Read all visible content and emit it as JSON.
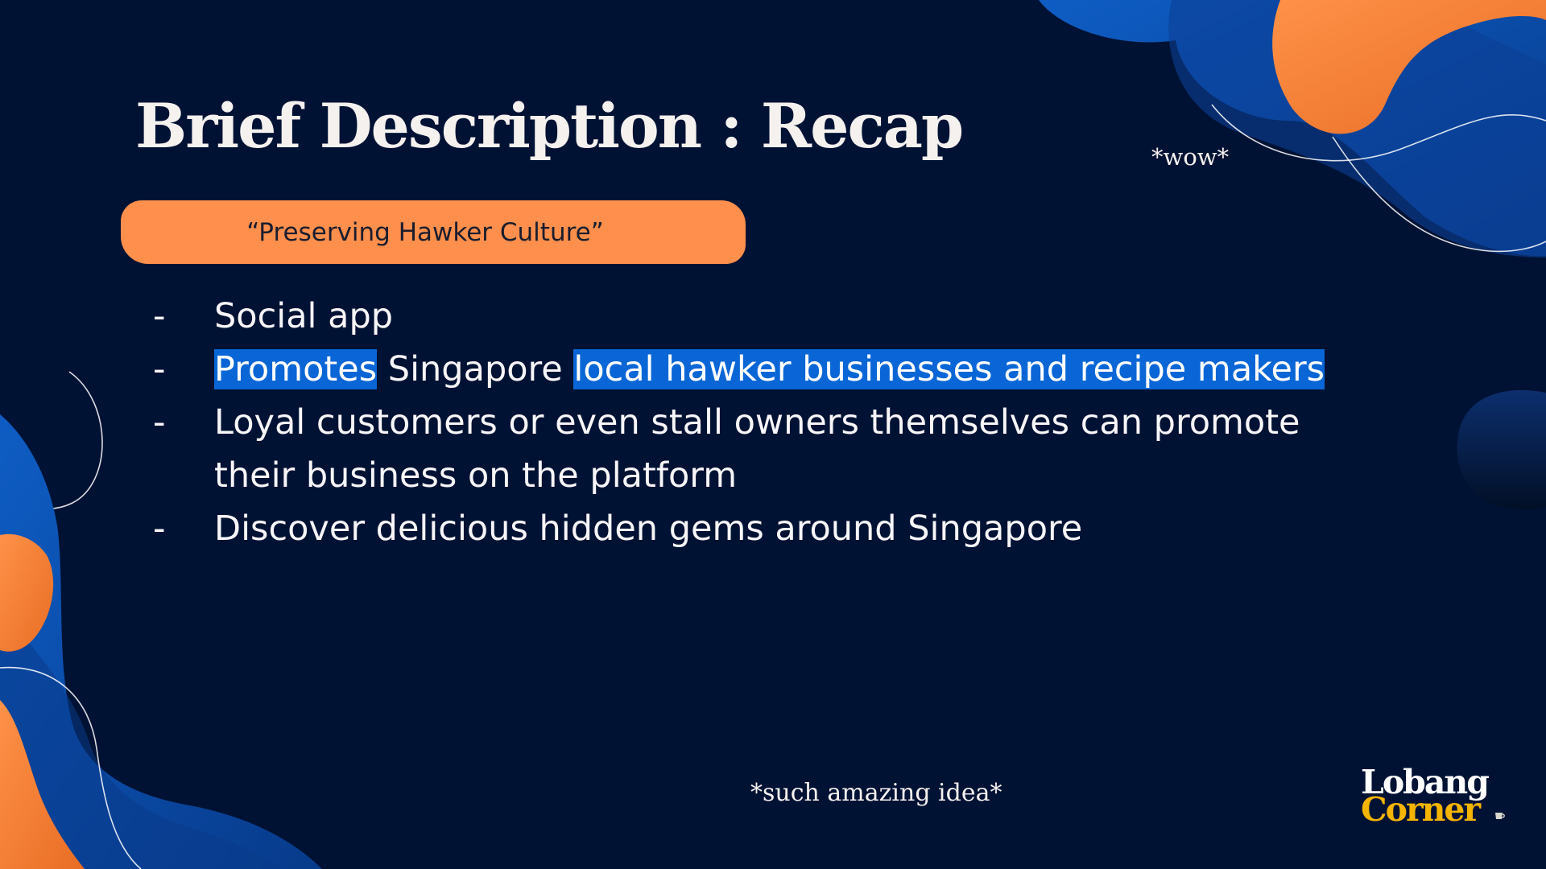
{
  "slide": {
    "title": "Brief Description : Recap",
    "tagline": "“Preserving Hawker Culture”",
    "annotation_top": "*wow*",
    "annotation_bottom": "*such amazing idea*"
  },
  "bullets": [
    {
      "marker": "-",
      "lines": [
        {
          "text": "Social app"
        }
      ]
    },
    {
      "marker": "-",
      "lines": [
        {
          "segments": [
            {
              "text": "Promotes",
              "highlight": true
            },
            {
              "text": " Singapore ",
              "highlight": false
            },
            {
              "text": "local hawker businesses and recipe makers",
              "highlight": true
            }
          ]
        }
      ]
    },
    {
      "marker": "-",
      "lines": [
        {
          "text": "Loyal customers or even stall owners themselves can promote"
        },
        {
          "text": "their business on the platform"
        }
      ]
    },
    {
      "marker": "-",
      "lines": [
        {
          "text": "Discover delicious hidden gems around Singapore"
        }
      ]
    }
  ],
  "logo": {
    "line1": "Lobang",
    "line2": "Corner",
    "icon": "cup-icon",
    "colors": {
      "line1": "#ffffff",
      "line2": "#f4b400"
    }
  },
  "colors": {
    "background": "#001233",
    "pill": "#ff8f4c",
    "highlight": "#0a66d6",
    "blob_blue": "#0a50a8",
    "blob_orange": "#ff8a3d"
  }
}
